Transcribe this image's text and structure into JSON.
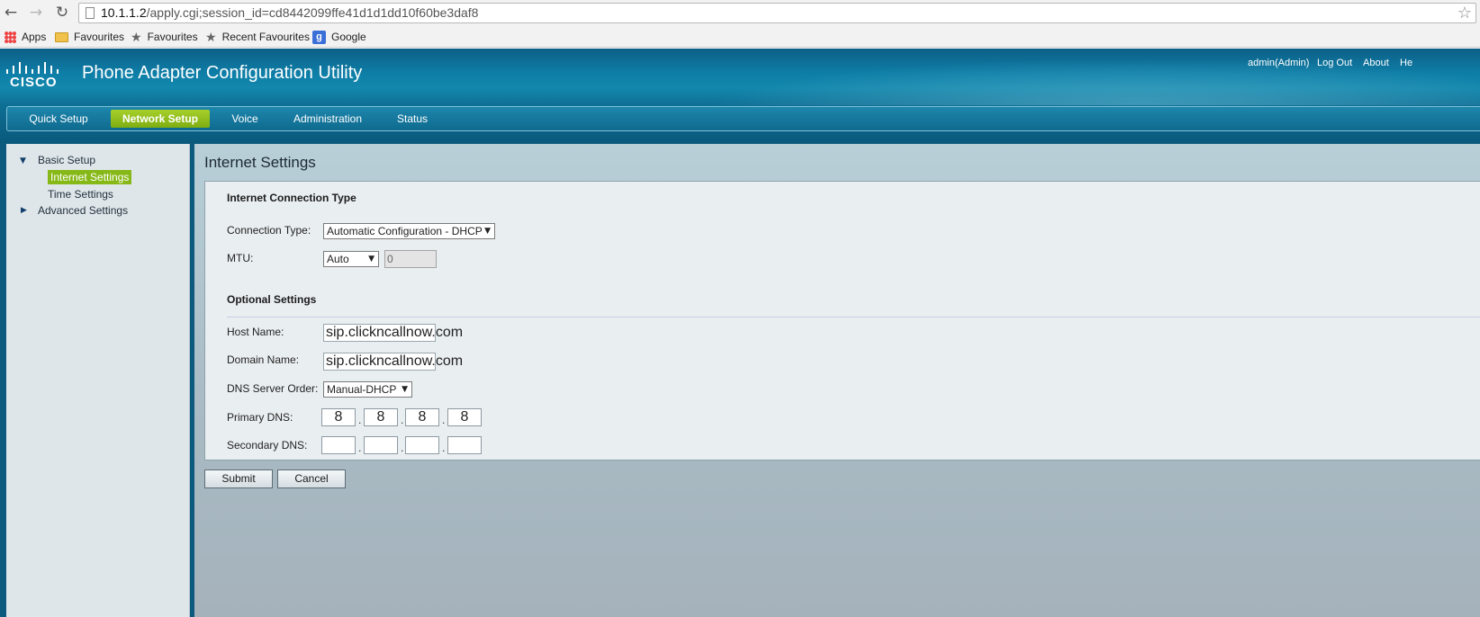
{
  "browser": {
    "url_host": "10.1.1.2",
    "url_path": "/apply.cgi;session_id=cd8442099ffe41d1d1dd10f60be3daf8",
    "bookmarks": [
      {
        "label": "Apps",
        "icon": "apps-icon"
      },
      {
        "label": "Favourites",
        "icon": "folder-icon"
      },
      {
        "label": "Favourites",
        "icon": "star-icon"
      },
      {
        "label": "Recent Favourites",
        "icon": "star-icon"
      },
      {
        "label": "Google",
        "icon": "google-icon"
      }
    ]
  },
  "header": {
    "brand": "CISCO",
    "title": "Phone Adapter Configuration Utility",
    "user": "admin(Admin)",
    "logout": "Log Out",
    "about": "About",
    "help": "He"
  },
  "nav": {
    "tabs": [
      "Quick Setup",
      "Network Setup",
      "Voice",
      "Administration",
      "Status"
    ],
    "active": "Network Setup"
  },
  "sidebar": {
    "basic_setup": "Basic Setup",
    "internet_settings": "Internet Settings",
    "time_settings": "Time Settings",
    "advanced_settings": "Advanced Settings"
  },
  "page": {
    "title": "Internet Settings",
    "section_connection": "Internet Connection Type",
    "connection_type_label": "Connection Type:",
    "connection_type_value": "Automatic Configuration - DHCP",
    "mtu_label": "MTU:",
    "mtu_mode": "Auto",
    "mtu_value": "0",
    "section_optional": "Optional Settings",
    "host_name_label": "Host Name:",
    "host_name_value": "sip.clickncallnow.com",
    "domain_name_label": "Domain Name:",
    "domain_name_value": "sip.clickncallnow.com",
    "dns_order_label": "DNS Server Order:",
    "dns_order_value": "Manual-DHCP",
    "primary_dns_label": "Primary DNS:",
    "primary_dns": [
      "8",
      "8",
      "8",
      "8"
    ],
    "secondary_dns_label": "Secondary DNS:",
    "secondary_dns": [
      "",
      "",
      "",
      ""
    ]
  },
  "buttons": {
    "submit": "Submit",
    "cancel": "Cancel"
  }
}
